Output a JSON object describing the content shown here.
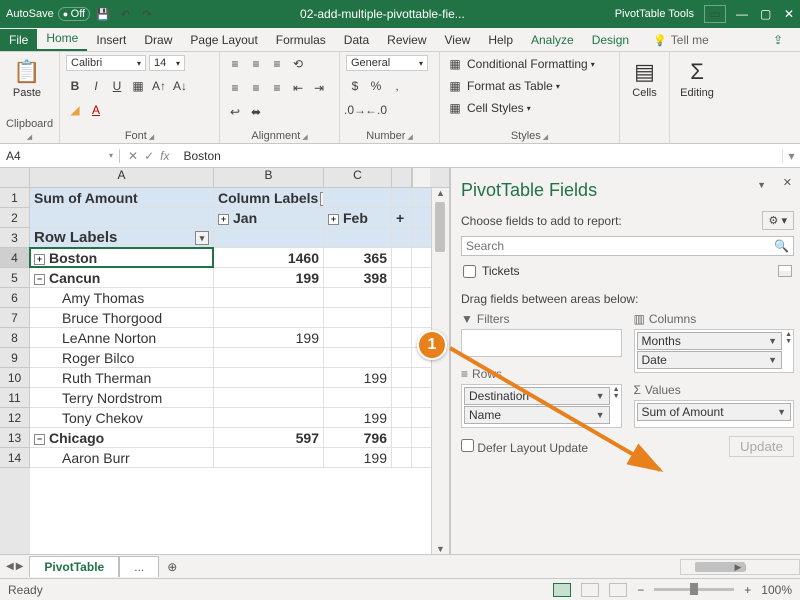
{
  "titlebar": {
    "autosave_label": "AutoSave",
    "autosave_state": "Off",
    "filename": "02-add-multiple-pivottable-fie...",
    "tools_label": "PivotTable Tools"
  },
  "tabs": {
    "file": "File",
    "home": "Home",
    "insert": "Insert",
    "draw": "Draw",
    "pageLayout": "Page Layout",
    "formulas": "Formulas",
    "data": "Data",
    "review": "Review",
    "view": "View",
    "help": "Help",
    "analyze": "Analyze",
    "design": "Design",
    "tellme": "Tell me"
  },
  "ribbon": {
    "paste": "Paste",
    "font_name": "Calibri",
    "font_size": "14",
    "number_format": "General",
    "cond_fmt": "Conditional Formatting",
    "as_table": "Format as Table",
    "cell_styles": "Cell Styles",
    "cells": "Cells",
    "editing": "Editing",
    "groups": {
      "clipboard": "Clipboard",
      "font": "Font",
      "alignment": "Alignment",
      "number": "Number",
      "styles": "Styles"
    }
  },
  "namebar": {
    "cell_ref": "A4",
    "formula": "Boston"
  },
  "columns": {
    "A": "A",
    "B": "B",
    "C": "C"
  },
  "pivot": {
    "sum_label": "Sum of Amount",
    "col_labels": "Column Labels",
    "jan": "Jan",
    "feb": "Feb",
    "row_labels": "Row Labels",
    "rows": [
      {
        "n": "4",
        "label": "Boston",
        "b": "1460",
        "c": "365",
        "bold": true,
        "exp": "+"
      },
      {
        "n": "5",
        "label": "Cancun",
        "b": "199",
        "c": "398",
        "bold": true,
        "exp": "−"
      },
      {
        "n": "6",
        "label": "Amy Thomas",
        "b": "",
        "c": ""
      },
      {
        "n": "7",
        "label": "Bruce Thorgood",
        "b": "",
        "c": ""
      },
      {
        "n": "8",
        "label": "LeAnne Norton",
        "b": "199",
        "c": ""
      },
      {
        "n": "9",
        "label": "Roger Bilco",
        "b": "",
        "c": ""
      },
      {
        "n": "10",
        "label": "Ruth Therman",
        "b": "",
        "c": "199"
      },
      {
        "n": "11",
        "label": "Terry Nordstrom",
        "b": "",
        "c": ""
      },
      {
        "n": "12",
        "label": "Tony Chekov",
        "b": "",
        "c": "199"
      },
      {
        "n": "13",
        "label": "Chicago",
        "b": "597",
        "c": "796",
        "bold": true,
        "exp": "−"
      },
      {
        "n": "14",
        "label": "Aaron Burr",
        "b": "",
        "c": "199"
      }
    ]
  },
  "taskpane": {
    "title": "PivotTable Fields",
    "choose": "Choose fields to add to report:",
    "search_placeholder": "Search",
    "field_tickets": "Tickets",
    "drag_hint": "Drag fields between areas below:",
    "filters": "Filters",
    "columns": "Columns",
    "rows": "Rows",
    "values": "Values",
    "months": "Months",
    "date": "Date",
    "destination": "Destination",
    "name": "Name",
    "sum_amount": "Sum of Amount",
    "defer": "Defer Layout Update",
    "update": "Update"
  },
  "sheet_tabs": {
    "active": "PivotTable",
    "overflow": "..."
  },
  "statusbar": {
    "ready": "Ready",
    "zoom": "100%"
  },
  "callout": {
    "num": "1"
  }
}
